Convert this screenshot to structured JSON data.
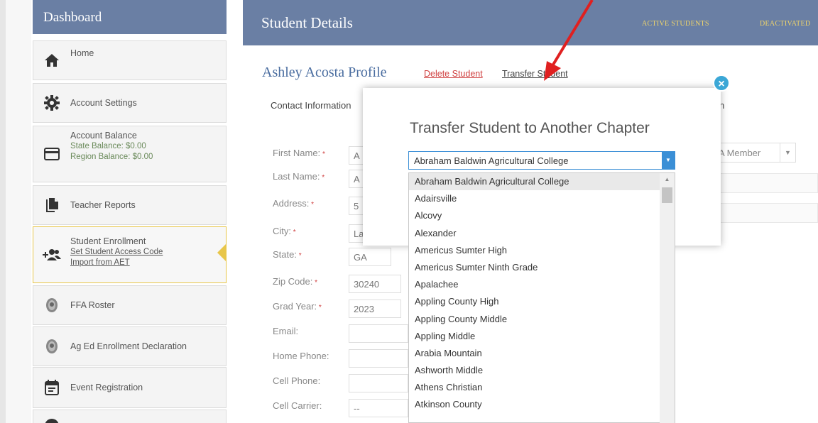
{
  "sidebar": {
    "title": "Dashboard",
    "items": [
      {
        "icon": "home-icon",
        "label": "Home"
      },
      {
        "icon": "gear-icon",
        "label": "Account Settings"
      },
      {
        "icon": "credit-card-icon",
        "label": "Account Balance",
        "sub1": "State Balance: $0.00",
        "sub2": "Region Balance: $0.00"
      },
      {
        "icon": "document-copy-icon",
        "label": "Teacher Reports"
      },
      {
        "icon": "add-users-icon",
        "label": "Student Enrollment",
        "link1": "Set Student Access Code",
        "link2": "Import from AET"
      },
      {
        "icon": "ffa-emblem-icon",
        "label": "FFA Roster"
      },
      {
        "icon": "ffa-emblem-icon",
        "label": "Ag Ed Enrollment Declaration"
      },
      {
        "icon": "calendar-icon",
        "label": "Event Registration"
      }
    ]
  },
  "header": {
    "title": "Student Details",
    "tabs": [
      "ACTIVE STUDENTS",
      "DEACTIVATED"
    ]
  },
  "profile": {
    "name": "Ashley Acosta Profile",
    "delete_label": "Delete Student",
    "transfer_label": "Transfer Student",
    "section": "Contact Information"
  },
  "form": {
    "fields": [
      {
        "label": "First Name:",
        "required": true,
        "value": "A"
      },
      {
        "label": "Last Name:",
        "required": true,
        "value": "A"
      },
      {
        "label": "Address:",
        "required": true,
        "value": "5"
      },
      {
        "label": "City:",
        "required": true,
        "value": "La"
      },
      {
        "label": "State:",
        "required": true,
        "value": "GA"
      },
      {
        "label": "Zip Code:",
        "required": true,
        "value": "30240"
      },
      {
        "label": "Grad Year:",
        "required": true,
        "value": "2023"
      },
      {
        "label": "Email:",
        "required": false,
        "value": ""
      },
      {
        "label": "Home Phone:",
        "required": false,
        "value": ""
      },
      {
        "label": "Cell Phone:",
        "required": false,
        "value": ""
      },
      {
        "label": "Cell Carrier:",
        "required": false,
        "value": "--"
      }
    ],
    "right_select_value": "A Member",
    "right_header_fragment": "n"
  },
  "modal": {
    "title": "Transfer Student to Another Chapter",
    "selected": "Abraham Baldwin Agricultural College",
    "close_symbol": "×",
    "options": [
      "Abraham Baldwin Agricultural College",
      "Adairsville",
      "Alcovy",
      "Alexander",
      "Americus Sumter High",
      "Americus Sumter Ninth Grade",
      "Apalachee",
      "Appling County High",
      "Appling County Middle",
      "Appling Middle",
      "Arabia Mountain",
      "Ashworth Middle",
      "Athens Christian",
      "Atkinson County"
    ]
  },
  "colors": {
    "header_blue": "#6a7fa4",
    "accent_yellow": "#e8c64a",
    "required_red": "#d04040",
    "link_blue": "#4a6da0",
    "combo_blue": "#3b8fd6",
    "annotation_red": "#e02020"
  }
}
